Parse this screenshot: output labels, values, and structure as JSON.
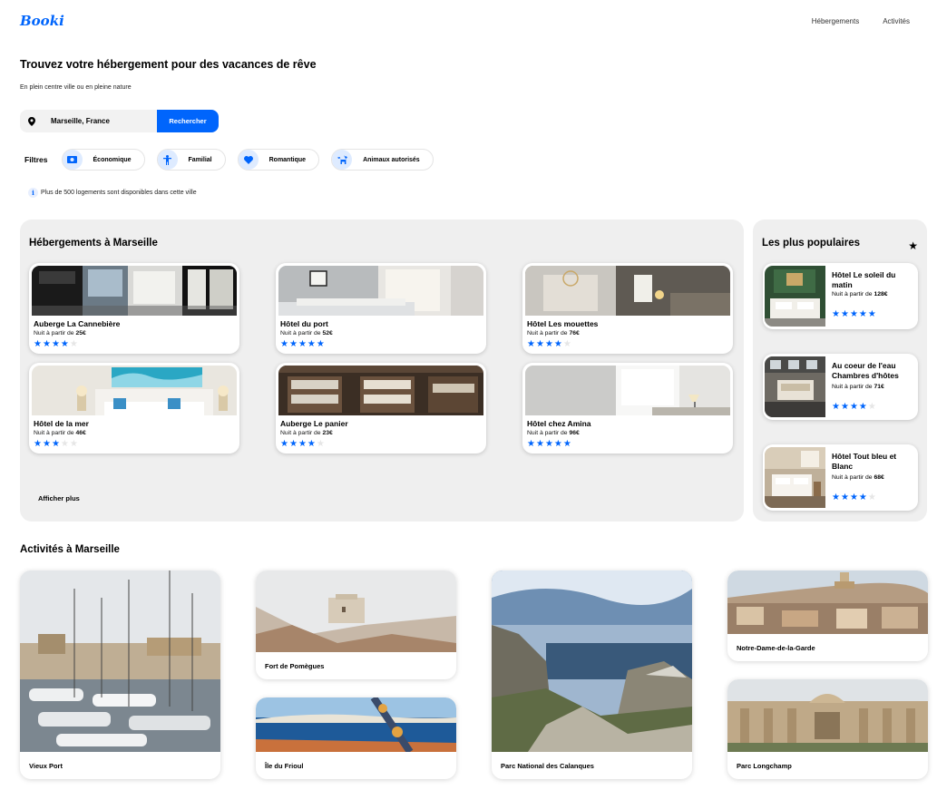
{
  "header": {
    "logo": "Booki",
    "nav": [
      "Hébergements",
      "Activités"
    ]
  },
  "hero": {
    "title": "Trouvez votre hébergement pour des vacances de rêve",
    "subtitle": "En plein centre ville ou en pleine nature"
  },
  "search": {
    "value": "Marseille, France",
    "button": "Rechercher",
    "icon": "location-pin-icon"
  },
  "filters": {
    "label": "Filtres",
    "items": [
      {
        "label": "Économique",
        "icon": "money-icon"
      },
      {
        "label": "Familial",
        "icon": "child-icon"
      },
      {
        "label": "Romantique",
        "icon": "heart-icon"
      },
      {
        "label": "Animaux autorisés",
        "icon": "dog-icon"
      }
    ]
  },
  "info": {
    "icon": "i",
    "text": "Plus de 500 logements sont disponibles dans cette ville"
  },
  "hebergements": {
    "title": "Hébergements à Marseille",
    "price_prefix": "Nuit à partir de ",
    "items": [
      {
        "name": "Auberge La Cannebière",
        "price": "25€",
        "stars": 4
      },
      {
        "name": "Hôtel du port",
        "price": "52€",
        "stars": 5
      },
      {
        "name": "Hôtel Les mouettes",
        "price": "76€",
        "stars": 4
      },
      {
        "name": "Hôtel de la mer",
        "price": "46€",
        "stars": 3
      },
      {
        "name": "Auberge Le panier",
        "price": "23€",
        "stars": 4
      },
      {
        "name": "Hôtel chez Amina",
        "price": "96€",
        "stars": 5
      }
    ],
    "more": "Afficher plus"
  },
  "populaires": {
    "title": "Les plus populaires",
    "price_prefix": "Nuit à partir de ",
    "items": [
      {
        "name": "Hôtel Le soleil du matin",
        "price": "128€",
        "stars": 5
      },
      {
        "name": "Au coeur de l'eau Chambres d'hôtes",
        "price": "71€",
        "stars": 4
      },
      {
        "name": "Hôtel Tout bleu et Blanc",
        "price": "68€",
        "stars": 4
      }
    ]
  },
  "activites": {
    "title": "Activités à Marseille",
    "items": [
      {
        "name": "Vieux Port"
      },
      {
        "name": "Fort de Pomègues"
      },
      {
        "name": "Île du Frioul"
      },
      {
        "name": "Parc National des Calanques"
      },
      {
        "name": "Notre-Dame-de-la-Garde"
      },
      {
        "name": "Parc Longchamp"
      }
    ]
  },
  "colors": {
    "primary": "#0065FC",
    "section_bg": "#EFEFEF",
    "pill_icon_bg": "#DEEBFF"
  }
}
